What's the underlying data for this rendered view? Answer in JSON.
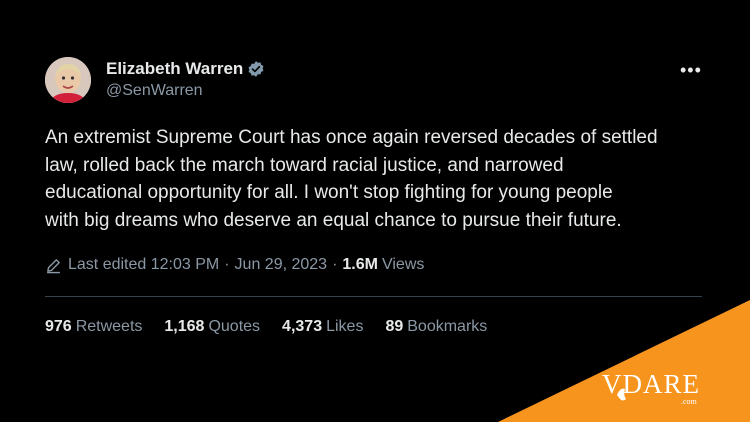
{
  "author": {
    "name": "Elizabeth Warren",
    "handle": "@SenWarren"
  },
  "more_label": "•••",
  "tweet_text": "An extremist Supreme Court has once again reversed decades of settled\nlaw, rolled back the march toward racial justice, and narrowed\neducational opportunity for all. I won't stop fighting for young people\nwith big dreams who deserve an equal chance to pursue their future.",
  "meta": {
    "edited": "Last edited 12:03 PM",
    "date": "Jun 29, 2023",
    "views_count": "1.6M",
    "views_label": "Views",
    "separator": "·"
  },
  "stats": {
    "retweets_count": "976",
    "retweets_label": "Retweets",
    "quotes_count": "1,168",
    "quotes_label": "Quotes",
    "likes_count": "4,373",
    "likes_label": "Likes",
    "bookmarks_count": "89",
    "bookmarks_label": "Bookmarks"
  },
  "watermark": {
    "brand": "VDARE",
    "domain": ".com",
    "color": "#f7941d"
  },
  "colors": {
    "background": "#000000",
    "text": "#e7e9ea",
    "secondary": "#8b98a5",
    "verified": "#829aab"
  }
}
